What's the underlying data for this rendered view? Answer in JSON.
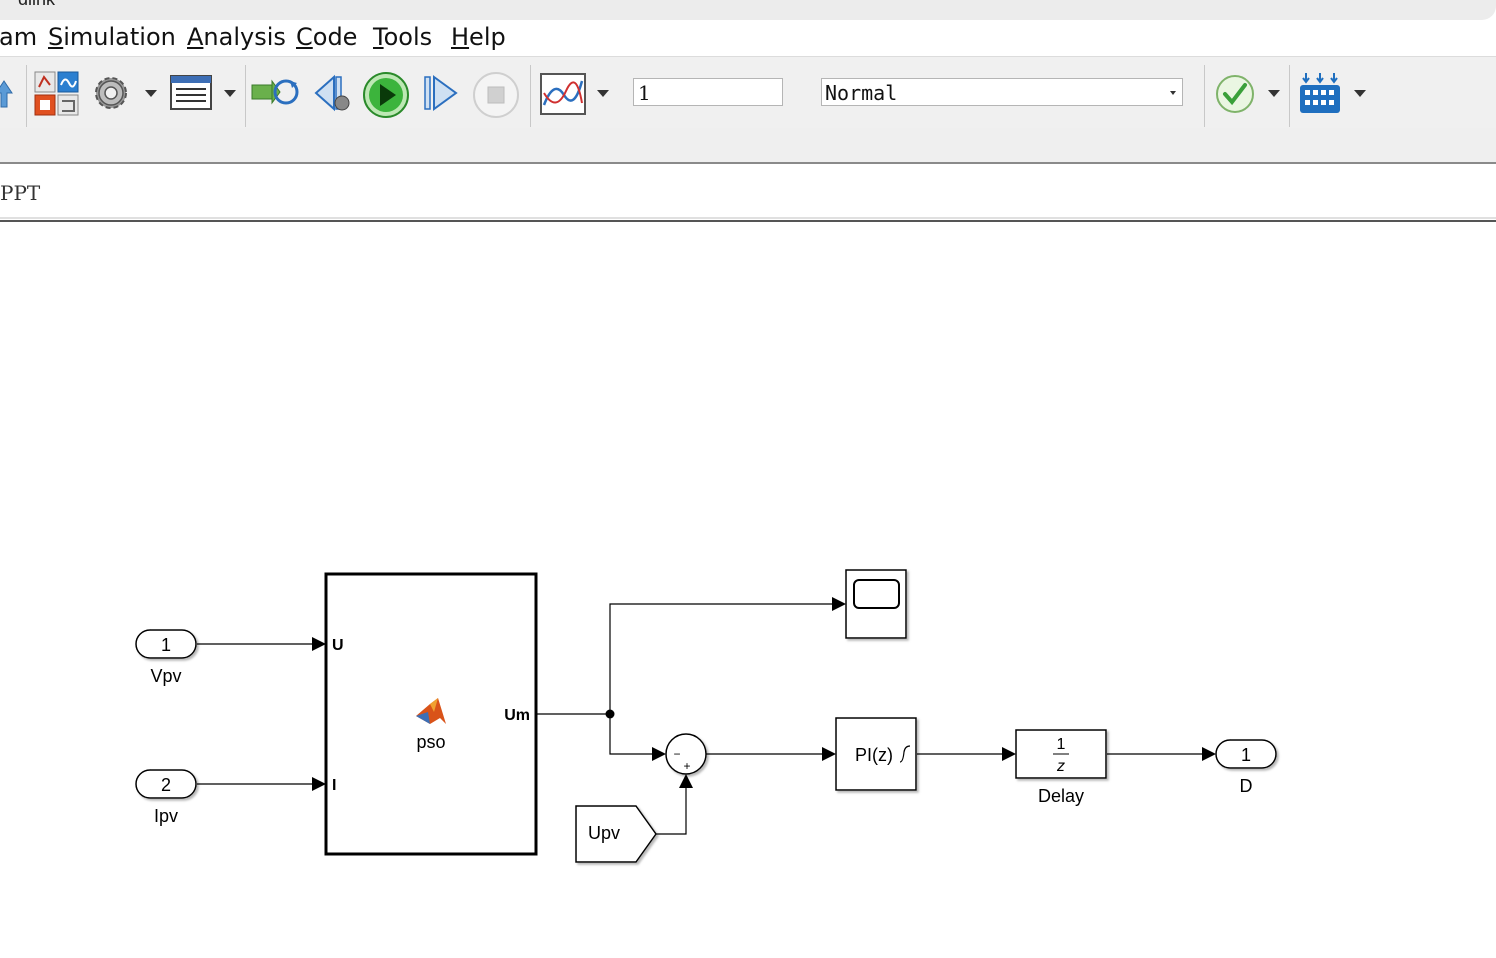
{
  "window": {
    "title_fragment": "dlink"
  },
  "menu": [
    "am",
    "Simulation",
    "Analysis",
    "Code",
    "Tools",
    "Help"
  ],
  "toolbar": {
    "stop_time": "1",
    "sim_mode": "Normal",
    "icons": [
      "up-arrow-icon",
      "library-browser-icon",
      "model-settings-icon",
      "model-explorer-icon",
      "update-diagram-icon",
      "step-back-icon",
      "run-icon",
      "step-forward-icon",
      "stop-icon",
      "scope-icon",
      "check-icon",
      "build-icon"
    ]
  },
  "breadcrumb": {
    "text": "PPT"
  },
  "diagram": {
    "inport1": {
      "number": "1",
      "label": "Vpv"
    },
    "inport2": {
      "number": "2",
      "label": "Ipv"
    },
    "function_block": {
      "name": "pso",
      "in1": "U",
      "in2": "I",
      "out": "Um"
    },
    "sum_signs": {
      "minus": "−",
      "plus": "+"
    },
    "goto_tag": "Upv",
    "pi_block": "PI(z)",
    "delay": {
      "num": "1",
      "den": "z",
      "label": "Delay"
    },
    "outport": {
      "number": "1",
      "label": "D"
    }
  },
  "colors": {
    "accent_green": "#2aa52a",
    "matlab_orange": "#d95319",
    "icon_blue": "#1f6fbf"
  }
}
